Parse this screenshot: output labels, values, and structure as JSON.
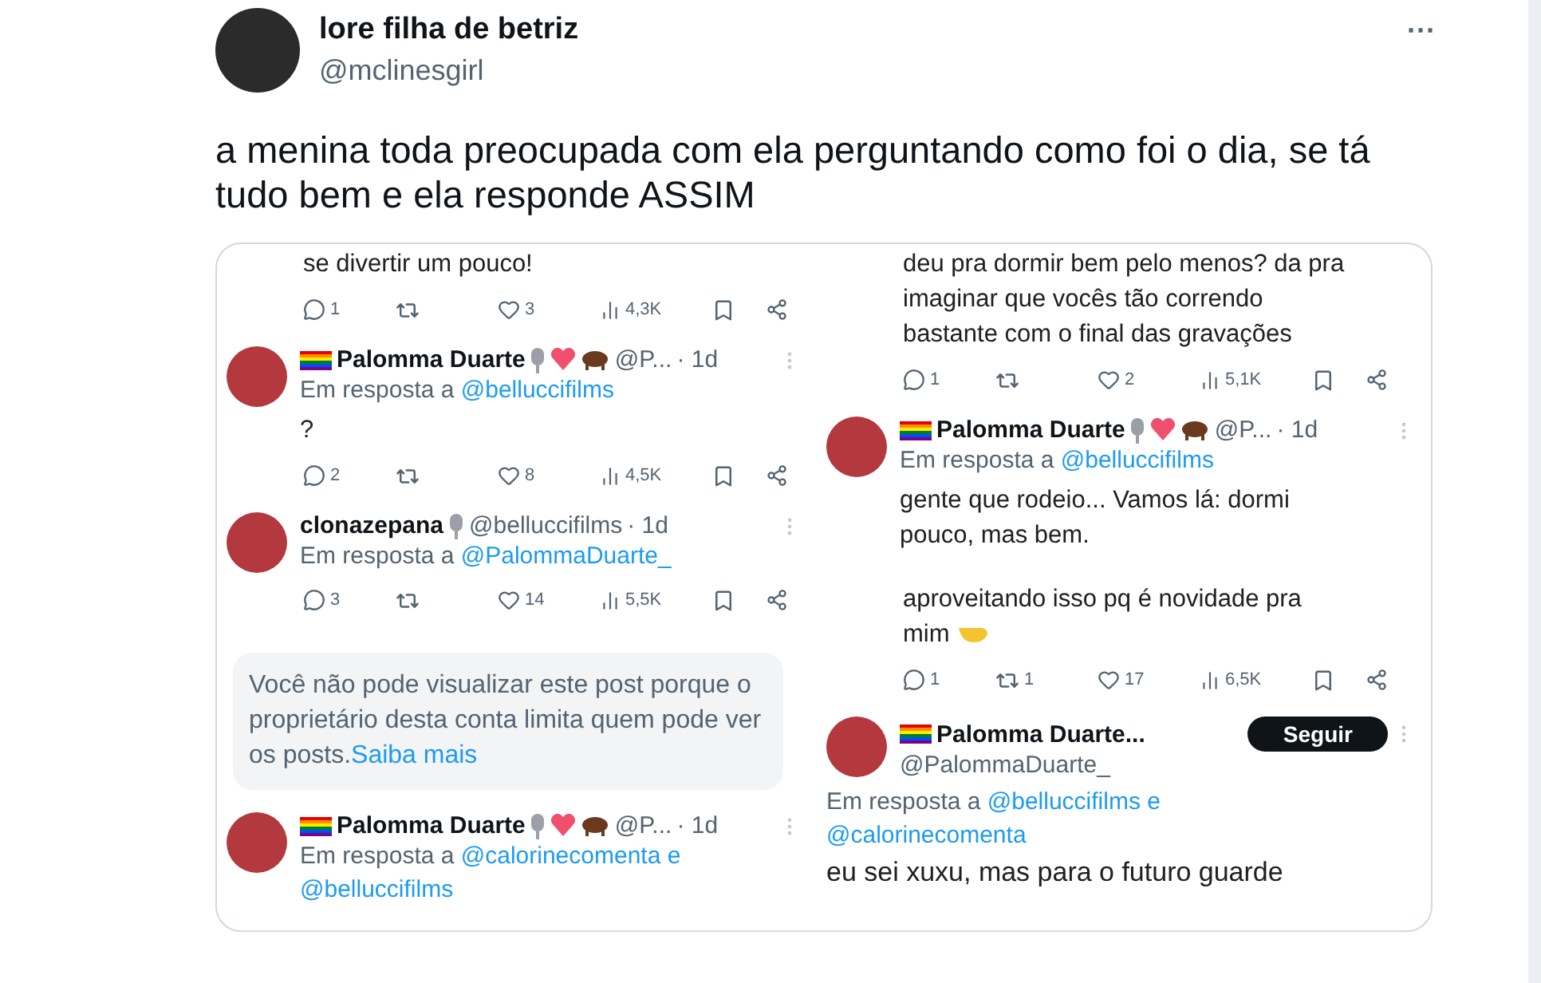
{
  "tweet": {
    "name": "lore filha de betriz",
    "handle": "@mclinesgirl",
    "menu": "···",
    "text": "a menina toda preocupada com ela perguntando como foi o dia, se tá tudo bem e ela responde ASSIM"
  },
  "embedded": {
    "columns": [
      {
        "items": [
          {
            "kind": "text",
            "body": "se divertir um pouco!"
          },
          {
            "kind": "stats",
            "replies": "1",
            "likes": "3",
            "views": "4,3K"
          },
          {
            "kind": "reply",
            "name": "Palomma Duarte",
            "handle": "@P...",
            "time": "· 1d",
            "reply_prefix": "Em resposta a",
            "mentions": [
              "@belluccifilms"
            ],
            "body": "?"
          },
          {
            "kind": "stats",
            "replies": "2",
            "likes": "8",
            "views": "4,5K"
          },
          {
            "kind": "reply_mic",
            "name": "clonazepana",
            "handle": "@belluccifilms",
            "time": "· 1d",
            "reply_prefix": "Em resposta a",
            "mentions": [
              "@PalommaDuarte_"
            ]
          },
          {
            "kind": "stats",
            "replies": "3",
            "likes": "14",
            "views": "5,5K"
          },
          {
            "kind": "notice",
            "text": "Você não pode visualizar este post porque o proprietário desta conta limita quem pode ver os posts.",
            "link": "Saiba mais"
          },
          {
            "kind": "reply",
            "name": "Palomma Duarte",
            "handle": "@P...",
            "time": "· 1d",
            "reply_prefix": "Em resposta a",
            "mentions": [
              "@calorinecomenta e",
              "@belluccifilms"
            ]
          }
        ]
      },
      {
        "items": [
          {
            "kind": "text",
            "body": "deu pra dormir bem pelo menos? da pra imaginar que vocês tão correndo bastante com o final das gravações"
          },
          {
            "kind": "stats",
            "replies": "1",
            "likes": "2",
            "views": "5,1K"
          },
          {
            "kind": "reply",
            "name": "Palomma Duarte",
            "handle": "@P...",
            "time": "· 1d",
            "reply_prefix": "Em resposta a",
            "mentions": [
              "@belluccifilms"
            ],
            "body": "gente que rodeio... Vamos lá: dormi pouco, mas bem."
          },
          {
            "kind": "text_hand",
            "body": "aproveitando isso pq é novidade pra mim"
          },
          {
            "kind": "stats",
            "replies": "1",
            "reposts": "1",
            "likes": "17",
            "views": "6,5K"
          },
          {
            "kind": "follow",
            "name": "Palomma Duarte...",
            "handle": "@PalommaDuarte_",
            "button": "Seguir",
            "reply_prefix": "Em resposta a",
            "mentions": [
              "@belluccifilms e",
              "@calorinecomenta"
            ],
            "body": "eu sei xuxu, mas para o futuro guarde"
          }
        ]
      }
    ]
  }
}
